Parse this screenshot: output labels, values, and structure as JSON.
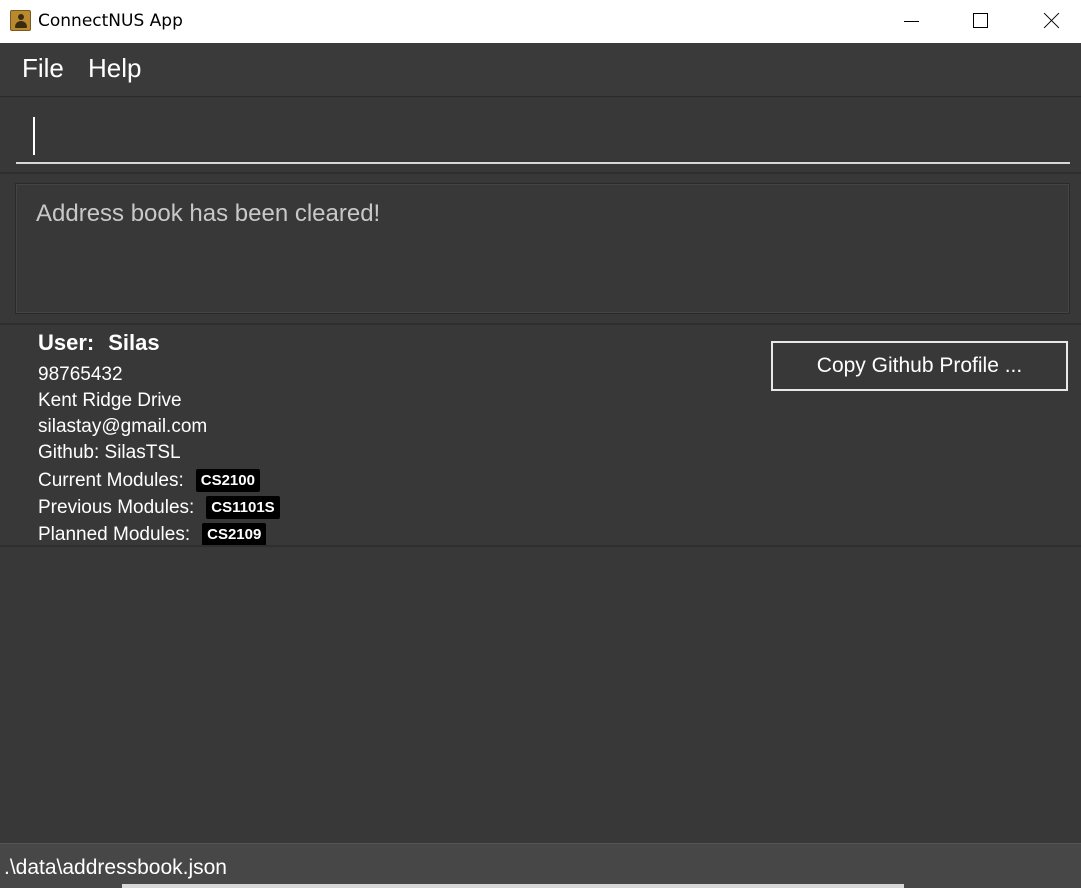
{
  "window": {
    "title": "ConnectNUS App"
  },
  "menu": {
    "items": [
      {
        "label": "File"
      },
      {
        "label": "Help"
      }
    ]
  },
  "command": {
    "value": ""
  },
  "result": {
    "message": "Address book has been cleared!"
  },
  "user": {
    "label": "User:",
    "name": "Silas",
    "phone": "98765432",
    "address": "Kent Ridge Drive",
    "email": "silastay@gmail.com",
    "github": "Github: SilasTSL",
    "current_label": "Current Modules:",
    "current_modules": [
      "CS2100"
    ],
    "previous_label": "Previous Modules:",
    "previous_modules": [
      "CS1101S"
    ],
    "planned_label": "Planned Modules:",
    "planned_modules": [
      "CS2109"
    ],
    "copy_button": "Copy Github Profile ..."
  },
  "status": {
    "path": ".\\data\\addressbook.json"
  },
  "icons": {
    "app": "address-book-icon",
    "minimize": "minimize-icon",
    "maximize": "maximize-icon",
    "close": "close-icon"
  }
}
